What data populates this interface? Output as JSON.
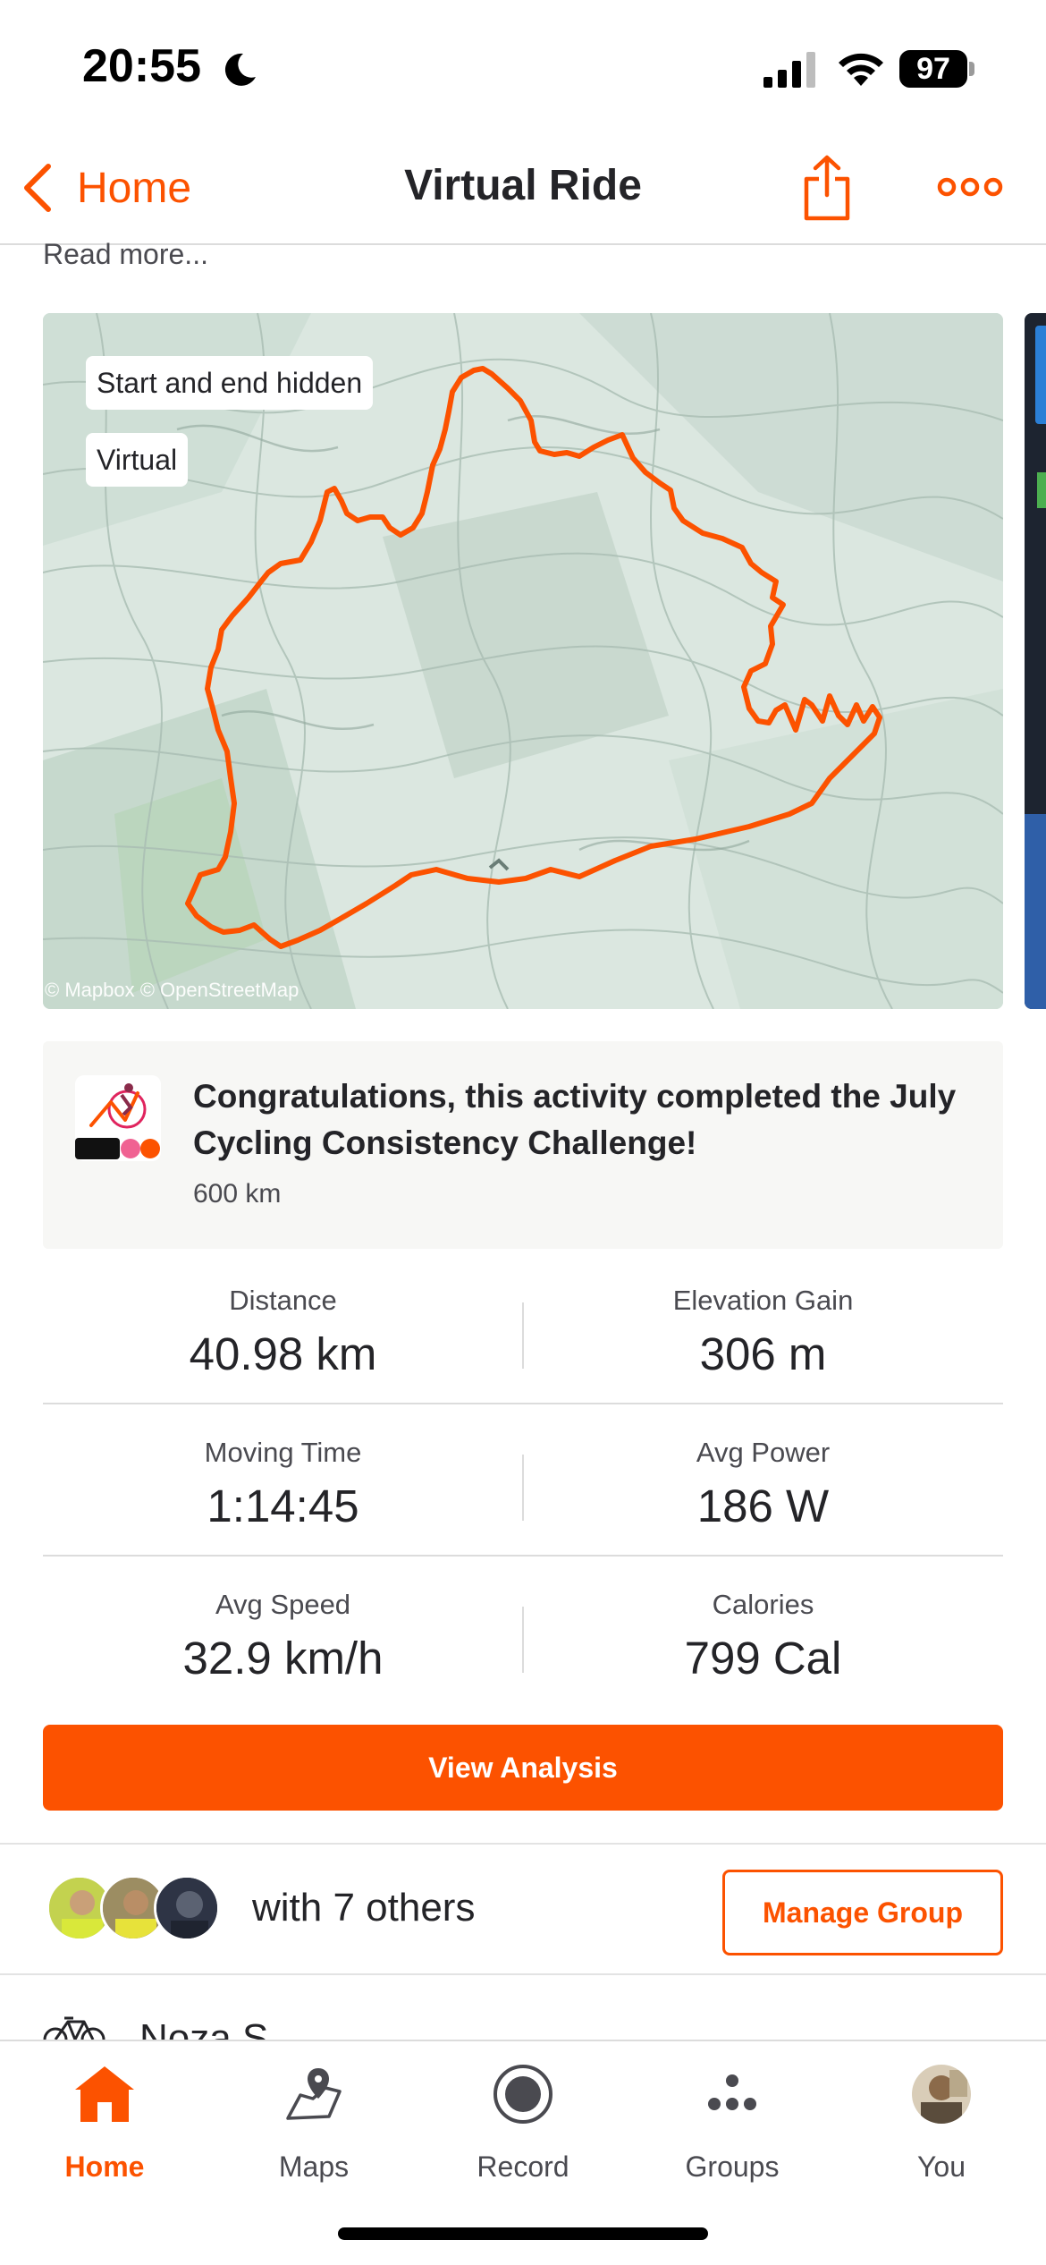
{
  "status_bar": {
    "time": "20:55",
    "battery": "97"
  },
  "header": {
    "back_label": "Home",
    "title": "Virtual Ride"
  },
  "read_more": "Read more...",
  "map": {
    "tags": [
      "Start and end hidden",
      "Virtual"
    ],
    "attribution": "© Mapbox © OpenStreetMap",
    "route_color": "#fc5200"
  },
  "challenge": {
    "badge_text": "600k",
    "message": "Congratulations, this activity completed the July Cycling Consistency Challenge!",
    "distance": "600 km"
  },
  "stats": [
    {
      "left": {
        "label": "Distance",
        "value": "40.98 km"
      },
      "right": {
        "label": "Elevation Gain",
        "value": "306 m"
      }
    },
    {
      "left": {
        "label": "Moving Time",
        "value": "1:14:45"
      },
      "right": {
        "label": "Avg Power",
        "value": "186 W"
      }
    },
    {
      "left": {
        "label": "Avg Speed",
        "value": "32.9 km/h"
      },
      "right": {
        "label": "Calories",
        "value": "799 Cal"
      }
    }
  ],
  "actions": {
    "view_analysis": "View Analysis",
    "manage_group": "Manage Group"
  },
  "group": {
    "with_others": "with 7 others"
  },
  "next_item": {
    "name": "Noza S",
    "icon": "bike-icon"
  },
  "tab_bar": {
    "tabs": [
      {
        "label": "Home",
        "icon": "home-icon",
        "active": true
      },
      {
        "label": "Maps",
        "icon": "maps-icon",
        "active": false
      },
      {
        "label": "Record",
        "icon": "record-icon",
        "active": false
      },
      {
        "label": "Groups",
        "icon": "groups-icon",
        "active": false
      },
      {
        "label": "You",
        "icon": "profile-avatar",
        "active": false
      }
    ]
  },
  "colors": {
    "accent": "#fc5200",
    "text": "#242428",
    "muted": "#4a4a50",
    "card_bg": "#f7f7f5"
  }
}
